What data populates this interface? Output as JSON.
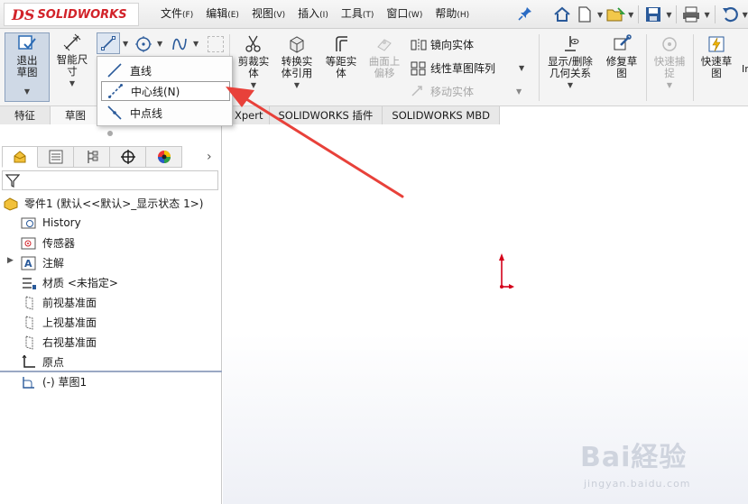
{
  "app": {
    "logo_ds": "DS",
    "logo_name": "SOLIDWORKS"
  },
  "menu": [
    {
      "label": "文件",
      "key": "(F)"
    },
    {
      "label": "编辑",
      "key": "(E)"
    },
    {
      "label": "视图",
      "key": "(V)"
    },
    {
      "label": "插入",
      "key": "(I)"
    },
    {
      "label": "工具",
      "key": "(T)"
    },
    {
      "label": "窗口",
      "key": "(W)"
    },
    {
      "label": "帮助",
      "key": "(H)"
    }
  ],
  "toolbar": {
    "exit_sketch": "退出草图",
    "smart_dim": "智能尺寸",
    "trim": "剪裁实体",
    "convert": "转换实体引用",
    "offset": "等距实体",
    "surface_offset": "曲面上偏移",
    "mirror": "镜向实体",
    "linear_pattern": "线性草图阵列",
    "move": "移动实体",
    "show_relations": "显示/删除几何关系",
    "repair": "修复草图",
    "quick_snap": "快速捕捉",
    "rapid_sketch": "快速草图",
    "more": "In"
  },
  "cmd_tabs": {
    "features": "特征",
    "sketch": "草图",
    "dimxpert": "Xpert",
    "addins": "SOLIDWORKS 插件",
    "mbd": "SOLIDWORKS MBD"
  },
  "flyout": {
    "line": "直线",
    "centerline": "中心线(N)",
    "midpoint_line": "中点线"
  },
  "tree": {
    "part": "零件1 (默认<<默认>_显示状态 1>)",
    "history": "History",
    "sensors": "传感器",
    "annotations": "注解",
    "material": "材质 <未指定>",
    "front_plane": "前视基准面",
    "top_plane": "上视基准面",
    "right_plane": "右视基准面",
    "origin": "原点",
    "sketch": "(-) 草图1"
  },
  "watermark": {
    "main": "Bai経验",
    "sub": "jingyan.baidu.com"
  },
  "colors": {
    "brand": "#d2232a",
    "arrow": "#e8413a",
    "origin": "#d4001a",
    "panel_border": "#c9c9c9"
  }
}
